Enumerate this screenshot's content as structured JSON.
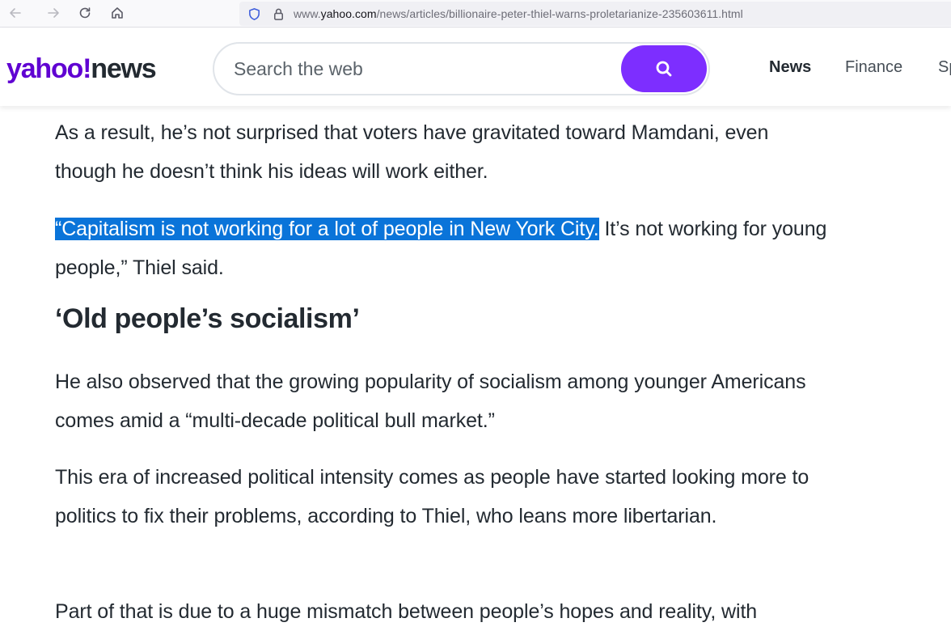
{
  "browser": {
    "url_prefix": "www.",
    "url_domain": "yahoo.com",
    "url_path": "/news/articles/billionaire-peter-thiel-warns-proletarianize-235603611.html"
  },
  "header": {
    "logo_yahoo": "yahoo!",
    "logo_news": "news",
    "search_placeholder": "Search the web",
    "nav": [
      {
        "label": "News",
        "active": true
      },
      {
        "label": "Finance",
        "active": false
      },
      {
        "label": "Sp",
        "active": false
      }
    ]
  },
  "article": {
    "p1": "As a result, he’s not surprised that voters have gravitated toward Mamdani, even though he doesn’t think his ideas will work either.",
    "p2_highlighted": "“Capitalism is not working for a lot of people in New York City.",
    "p2_rest": " It’s not working for young people,” Thiel said.",
    "heading": "‘Old people’s socialism’",
    "p3": "He also observed that the growing popularity of socialism among younger Americans comes amid a “multi-decade political bull market.”",
    "p4": "This era of increased political intensity comes as people have started looking more to politics to fix their problems, according to Thiel, who leans more libertarian.",
    "p5": "Part of that is due to a huge mismatch between people’s hopes and reality, with"
  },
  "colors": {
    "brand_purple": "#6001d2",
    "search_button": "#7d2eff",
    "selection_highlight": "#0a74d9"
  }
}
